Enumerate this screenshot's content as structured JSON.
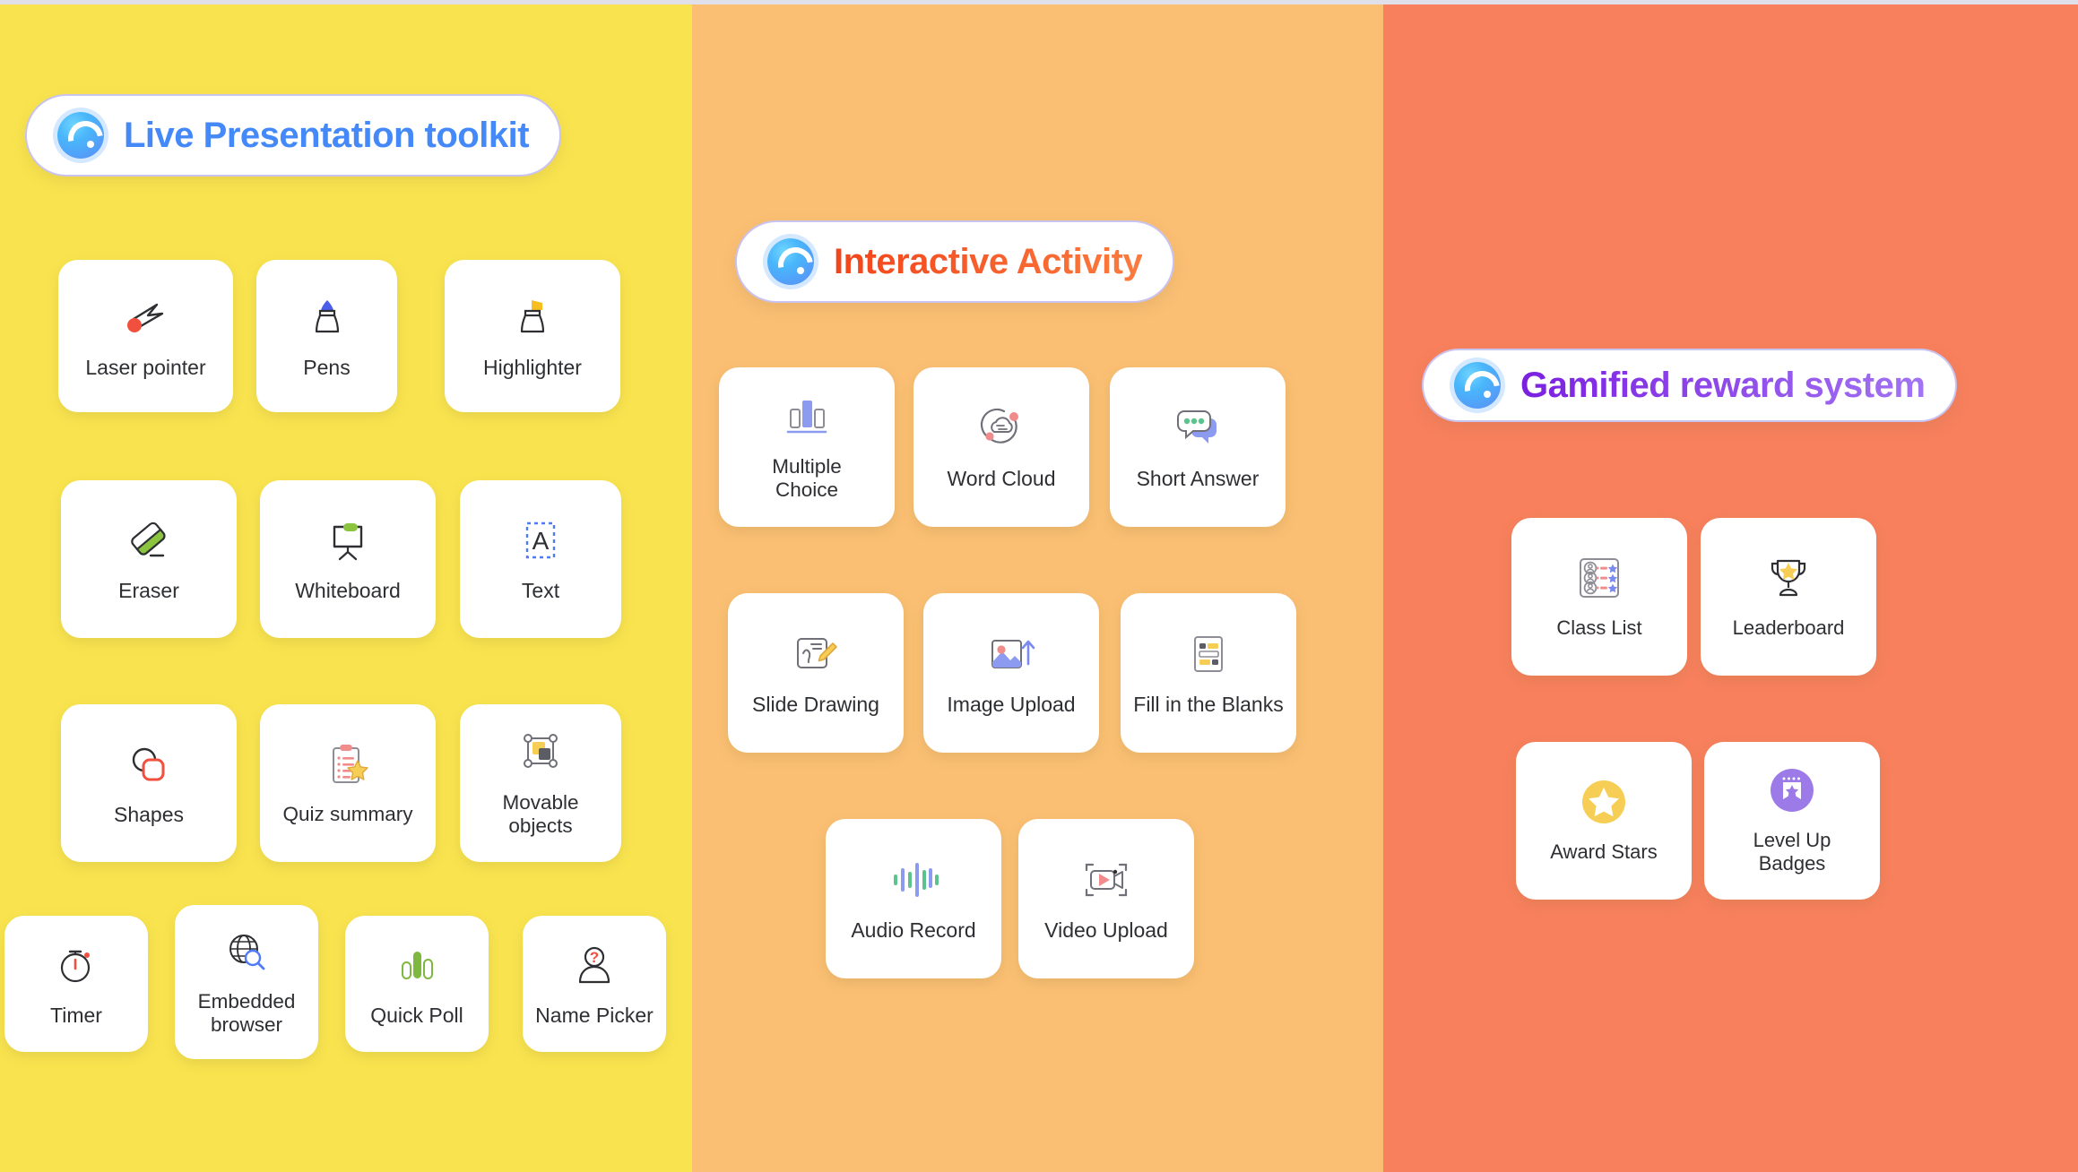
{
  "meta": {
    "colors": {
      "panel_yellow": "#F9E44F",
      "panel_orange": "#FABF73",
      "panel_coral": "#F8805D",
      "card_white": "#FFFFFF",
      "title_blue": "#4489F7",
      "title_orange": "#F2551F",
      "title_purple": "#8D3FE8",
      "pill_border": "#C9C3F2",
      "label_text": "#2E2F33"
    }
  },
  "panels": [
    {
      "id": "live-presentation-toolkit",
      "header": {
        "logo_icon": "circle-c-logo-icon",
        "title": "Live Presentation toolkit",
        "title_style": "title-blue"
      },
      "tiles": [
        {
          "label": "Laser pointer",
          "icon": "laser-pointer-icon"
        },
        {
          "label": "Pens",
          "icon": "pen-icon"
        },
        {
          "label": "Highlighter",
          "icon": "highlighter-icon"
        },
        {
          "label": "Eraser",
          "icon": "eraser-icon"
        },
        {
          "label": "Whiteboard",
          "icon": "whiteboard-icon"
        },
        {
          "label": "Text",
          "icon": "text-box-icon"
        },
        {
          "label": "Shapes",
          "icon": "shapes-icon"
        },
        {
          "label": "Quiz summary",
          "icon": "quiz-summary-icon"
        },
        {
          "label": "Movable\nobjects",
          "icon": "movable-objects-icon"
        },
        {
          "label": "Timer",
          "icon": "timer-icon"
        },
        {
          "label": "Embedded\nbrowser",
          "icon": "embedded-browser-icon"
        },
        {
          "label": "Quick Poll",
          "icon": "quick-poll-icon"
        },
        {
          "label": "Name Picker",
          "icon": "name-picker-icon"
        }
      ]
    },
    {
      "id": "interactive-activity",
      "header": {
        "logo_icon": "circle-c-logo-icon",
        "title": "Interactive Activity",
        "title_style": "title-orange"
      },
      "tiles": [
        {
          "label": "Multiple\nChoice",
          "icon": "bar-chart-icon"
        },
        {
          "label": "Word Cloud",
          "icon": "word-cloud-icon"
        },
        {
          "label": "Short Answer",
          "icon": "chat-bubbles-icon"
        },
        {
          "label": "Slide Drawing",
          "icon": "slide-drawing-icon"
        },
        {
          "label": "Image Upload",
          "icon": "image-upload-icon"
        },
        {
          "label": "Fill in the Blanks",
          "icon": "fill-in-blanks-icon"
        },
        {
          "label": "Audio Record",
          "icon": "audio-waveform-icon"
        },
        {
          "label": "Video Upload",
          "icon": "video-upload-icon"
        }
      ]
    },
    {
      "id": "gamified-reward-system",
      "header": {
        "logo_icon": "circle-c-logo-icon",
        "title": "Gamified reward system",
        "title_style": "title-purple"
      },
      "tiles": [
        {
          "label": "Class List",
          "icon": "class-list-icon"
        },
        {
          "label": "Leaderboard",
          "icon": "trophy-icon"
        },
        {
          "label": "Award Stars",
          "icon": "star-circle-icon"
        },
        {
          "label": "Level Up\nBadges",
          "icon": "badge-icon"
        }
      ]
    }
  ]
}
